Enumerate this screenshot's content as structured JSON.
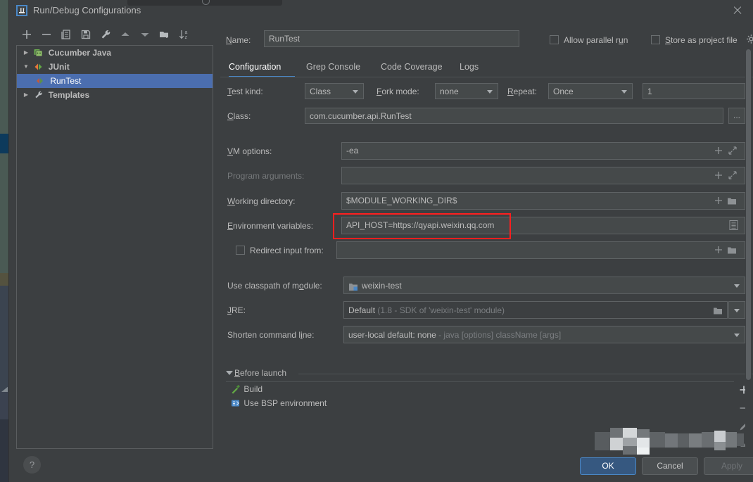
{
  "window": {
    "title": "Run/Debug Configurations",
    "app_icon": "intellij-idea-logo",
    "close_icon": "close-icon"
  },
  "toolbar": {
    "buttons": [
      {
        "name": "add-configuration-button",
        "icon": "plus-icon",
        "tooltip": "Add New Configuration"
      },
      {
        "name": "remove-configuration-button",
        "icon": "minus-icon",
        "tooltip": "Remove Configuration"
      },
      {
        "name": "copy-configuration-button",
        "icon": "copy-icon",
        "tooltip": "Copy Configuration"
      },
      {
        "name": "save-configuration-button",
        "icon": "save-icon",
        "tooltip": "Save Configuration"
      },
      {
        "name": "edit-templates-button",
        "icon": "wrench-icon",
        "tooltip": "Edit Templates"
      },
      {
        "name": "move-up-button",
        "icon": "arrow-up-icon",
        "tooltip": "Move Up"
      },
      {
        "name": "move-down-button",
        "icon": "arrow-down-icon",
        "tooltip": "Move Down"
      },
      {
        "name": "new-folder-button",
        "icon": "new-folder-icon",
        "tooltip": "Create New Folder"
      },
      {
        "name": "sort-button",
        "icon": "sort-alphabetical-icon",
        "tooltip": "Sort Configurations"
      }
    ]
  },
  "tree": {
    "items": [
      {
        "label": "Cucumber Java",
        "icon": "cucumber-java-icon",
        "expanded": false,
        "twisty": "▶",
        "depth": 0,
        "bold": true,
        "selected": false
      },
      {
        "label": "JUnit",
        "icon": "junit-icon",
        "expanded": true,
        "twisty": "▼",
        "depth": 0,
        "bold": true,
        "selected": false
      },
      {
        "label": "RunTest",
        "icon": "junit-run-icon",
        "expanded": null,
        "twisty": "",
        "depth": 1,
        "bold": false,
        "selected": true
      },
      {
        "label": "Templates",
        "icon": "wrench-icon",
        "expanded": false,
        "twisty": "▶",
        "depth": 0,
        "bold": true,
        "selected": false
      }
    ]
  },
  "help": {
    "label": "?",
    "name": "help-button"
  },
  "header": {
    "name_label": "Name:",
    "name_value": "RunTest",
    "allow_parallel_run_label": "Allow parallel run",
    "allow_parallel_run_checked": false,
    "store_as_project_file_label": "Store as project file",
    "store_as_project_file_checked": false,
    "settings_gear_icon": "gear-icon"
  },
  "tabs": [
    {
      "label": "Configuration",
      "active": true
    },
    {
      "label": "Grep Console",
      "active": false
    },
    {
      "label": "Code Coverage",
      "active": false
    },
    {
      "label": "Logs",
      "active": false
    }
  ],
  "form": {
    "test_kind_label": "Test kind:",
    "test_kind_value": "Class",
    "fork_mode_label": "Fork mode:",
    "fork_mode_value": "none",
    "repeat_label": "Repeat:",
    "repeat_value": "Once",
    "repeat_count_value": "1",
    "class_label": "Class:",
    "class_value": "com.cucumber.api.RunTest",
    "class_browse_label": "...",
    "vm_options_label": "VM options:",
    "vm_options_value": "-ea",
    "program_arguments_label": "Program arguments:",
    "program_arguments_value": "",
    "working_directory_label": "Working directory:",
    "working_directory_value": "$MODULE_WORKING_DIR$",
    "environment_variables_label": "Environment variables:",
    "environment_variables_value": "API_HOST=https://qyapi.weixin.qq.com",
    "redirect_input_label": "Redirect input from:",
    "redirect_input_checked": false,
    "redirect_input_value": "",
    "use_classpath_label": "Use classpath of module:",
    "use_classpath_value": "weixin-test",
    "jre_label": "JRE:",
    "jre_value": "Default",
    "jre_value_hint": "(1.8 - SDK of 'weixin-test' module)",
    "shorten_command_line_label": "Shorten command line:",
    "shorten_command_line_value": "user-local default: none",
    "shorten_command_line_hint": "- java [options] className [args]"
  },
  "before_launch": {
    "title": "Before launch",
    "expanded": true,
    "items": [
      {
        "label": "Build",
        "icon": "build-hammer-icon"
      },
      {
        "label": "Use BSP environment",
        "icon": "bsp-environment-icon"
      }
    ],
    "side_buttons": [
      {
        "name": "add-task-button",
        "icon": "plus-icon"
      },
      {
        "name": "remove-task-button",
        "icon": "minus-icon"
      },
      {
        "name": "edit-task-button",
        "icon": "pencil-icon"
      },
      {
        "name": "move-task-up-button",
        "icon": "arrow-up-icon"
      }
    ]
  },
  "footer": {
    "ok_label": "OK",
    "cancel_label": "Cancel",
    "apply_label": "Apply",
    "apply_enabled": false
  },
  "annotation": {
    "highlight_color": "#ff1f1f",
    "highlight_target": "environment-variables-field"
  },
  "colors": {
    "dialog_background": "#3c3f41",
    "field_background": "#45494a",
    "selection_blue": "#4b6eaf",
    "accent_blue": "#4a88c7",
    "primary_button": "#365880",
    "text": "#bbbbbb",
    "text_dim": "#75787a"
  }
}
